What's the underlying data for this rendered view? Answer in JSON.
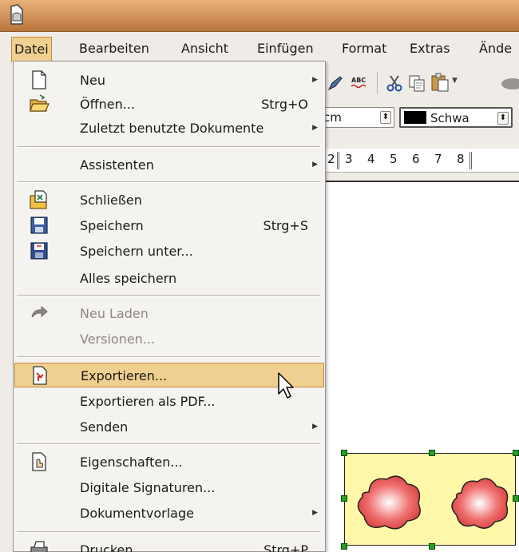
{
  "menubar": {
    "items": [
      {
        "label": "Datei",
        "active": true
      },
      {
        "label": "Bearbeiten"
      },
      {
        "label": "Ansicht"
      },
      {
        "label": "Einfügen"
      },
      {
        "label": "Format"
      },
      {
        "label": "Extras"
      },
      {
        "label": "Ände"
      }
    ]
  },
  "toolbar": {
    "unit_value": "cm",
    "color_value": "Schwa"
  },
  "ruler": {
    "numbers": [
      "2",
      "3",
      "4",
      "5",
      "6",
      "7",
      "8"
    ]
  },
  "file_menu": {
    "items": [
      {
        "icon": "new-document-icon",
        "label": "Neu",
        "shortcut": "",
        "submenu": true
      },
      {
        "icon": "open-folder-icon",
        "label": "Öffnen...",
        "shortcut": "Strg+O",
        "submenu": false
      },
      {
        "icon": "",
        "label": "Zuletzt benutzte Dokumente",
        "shortcut": "",
        "submenu": true
      },
      {
        "icon": "",
        "label": "Assistenten",
        "shortcut": "",
        "submenu": true
      },
      {
        "icon": "close-document-icon",
        "label": "Schließen",
        "shortcut": "",
        "submenu": false
      },
      {
        "icon": "save-disk-icon",
        "label": "Speichern",
        "shortcut": "Strg+S",
        "submenu": false
      },
      {
        "icon": "save-as-disk-icon",
        "label": "Speichern unter...",
        "shortcut": "",
        "submenu": false
      },
      {
        "icon": "",
        "label": "Alles speichern",
        "shortcut": "",
        "submenu": false
      },
      {
        "icon": "reload-icon",
        "label": "Neu Laden",
        "shortcut": "",
        "submenu": false,
        "disabled": true
      },
      {
        "icon": "",
        "label": "Versionen...",
        "shortcut": "",
        "submenu": false,
        "disabled": true
      },
      {
        "icon": "export-icon",
        "label": "Exportieren...",
        "shortcut": "",
        "submenu": false,
        "highlighted": true
      },
      {
        "icon": "",
        "label": "Exportieren als PDF...",
        "shortcut": "",
        "submenu": false
      },
      {
        "icon": "",
        "label": "Senden",
        "shortcut": "",
        "submenu": true
      },
      {
        "icon": "properties-icon",
        "label": "Eigenschaften...",
        "shortcut": "",
        "submenu": false
      },
      {
        "icon": "",
        "label": "Digitale Signaturen...",
        "shortcut": "",
        "submenu": false
      },
      {
        "icon": "",
        "label": "Dokumentvorlage",
        "shortcut": "",
        "submenu": true
      },
      {
        "icon": "printer-icon",
        "label": "Drucken...",
        "shortcut": "Strg+P",
        "submenu": false
      }
    ]
  },
  "colors": {
    "titlebar": "#c8864e",
    "highlight": "#f0d090",
    "shape_fill": "#fff8a8",
    "cloud": "#e06060",
    "handle": "#22a020"
  }
}
